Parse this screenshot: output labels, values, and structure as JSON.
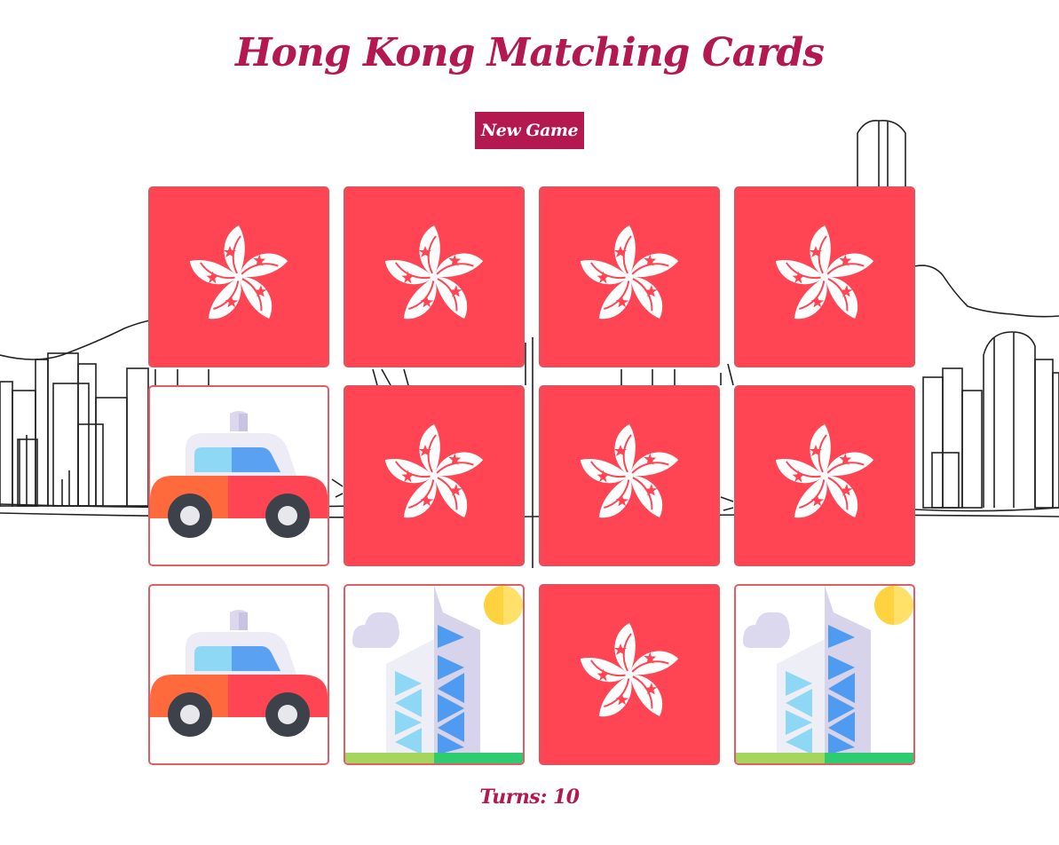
{
  "title": "Hong Kong Matching Cards",
  "new_game_label": "New Game",
  "turns": {
    "label": "Turns:",
    "value": "10"
  },
  "colors": {
    "accent": "#b3184f",
    "card_back": "#ff4553",
    "card_border": "#e25c66"
  },
  "background_icon": "hong-kong-skyline",
  "cards": [
    {
      "state": "face-down",
      "icon": "bauhinia-flower-icon"
    },
    {
      "state": "face-down",
      "icon": "bauhinia-flower-icon"
    },
    {
      "state": "face-down",
      "icon": "bauhinia-flower-icon"
    },
    {
      "state": "face-down",
      "icon": "bauhinia-flower-icon"
    },
    {
      "state": "matched",
      "icon": "taxi-icon"
    },
    {
      "state": "face-down",
      "icon": "bauhinia-flower-icon"
    },
    {
      "state": "face-down",
      "icon": "bauhinia-flower-icon"
    },
    {
      "state": "face-down",
      "icon": "bauhinia-flower-icon"
    },
    {
      "state": "matched",
      "icon": "taxi-icon"
    },
    {
      "state": "matched",
      "icon": "bank-tower-icon"
    },
    {
      "state": "face-down",
      "icon": "bauhinia-flower-icon"
    },
    {
      "state": "matched",
      "icon": "bank-tower-icon"
    }
  ]
}
